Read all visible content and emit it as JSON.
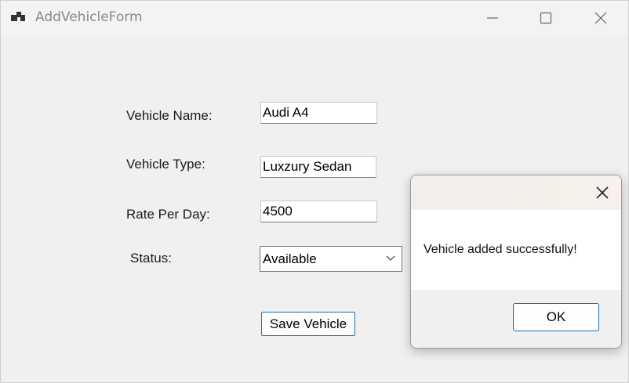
{
  "window": {
    "title": "AddVehicleForm",
    "icon": "app-window-icon",
    "controls": [
      "minimize-icon",
      "maximize-icon",
      "close-icon"
    ]
  },
  "form": {
    "vehicle_name_label": "Vehicle Name:",
    "vehicle_name_value": "Audi A4",
    "vehicle_type_label": "Vehicle Type:",
    "vehicle_type_value": "Luxzury Sedan",
    "rate_label": "Rate Per Day:",
    "rate_value": "4500",
    "status_label": "Status:",
    "status_value": "Available",
    "save_label": "Save Vehicle"
  },
  "message_box": {
    "message": "Vehicle added successfully!",
    "ok_label": "OK"
  },
  "colors": {
    "accent_border": "#1f6fb3",
    "window_bg": "#f0f0f0",
    "title_text": "#8a8a8a"
  }
}
